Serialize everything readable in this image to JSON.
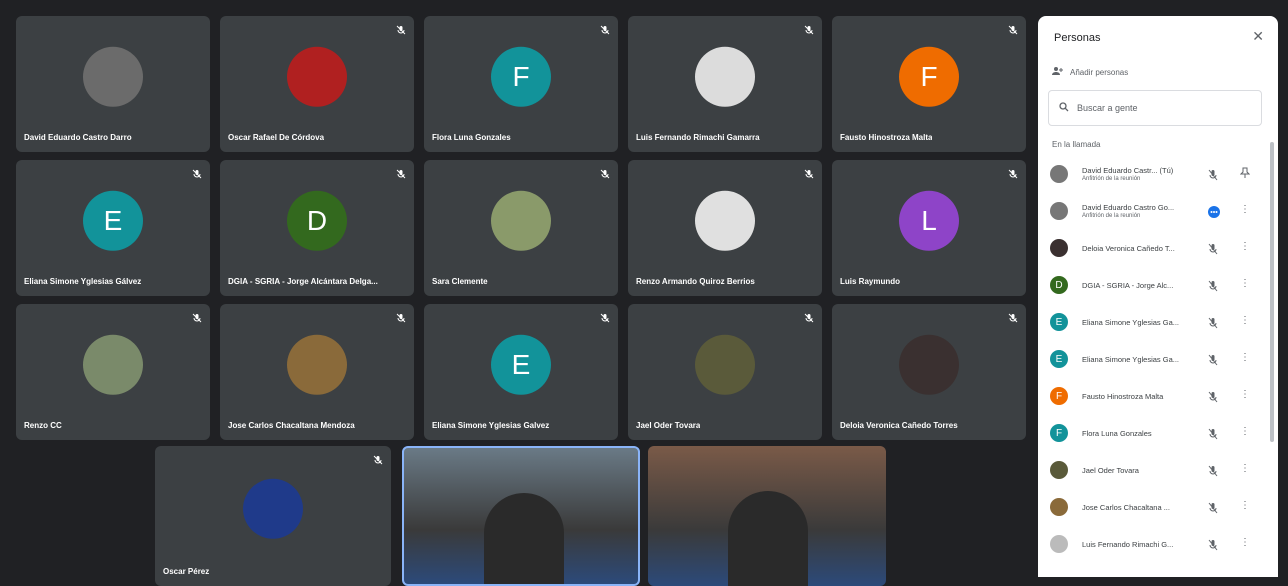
{
  "tiles": [
    {
      "name": "David Eduardo Castro Darro",
      "type": "photo",
      "avatar_color": "#6b6b6b"
    },
    {
      "name": "Oscar Rafael De Córdova",
      "type": "photo",
      "avatar_color": "#b02020"
    },
    {
      "name": "Flora Luna Gonzales",
      "type": "letter",
      "letter": "F",
      "avatar_color": "#12939a"
    },
    {
      "name": "Luis Fernando Rimachi Gamarra",
      "type": "photo",
      "avatar_color": "#dcdcdc"
    },
    {
      "name": "Fausto Hinostroza Malta",
      "type": "letter",
      "letter": "F",
      "avatar_color": "#ef6c00"
    },
    {
      "name": "Eliana Simone Yglesias Gálvez",
      "type": "letter",
      "letter": "E",
      "avatar_color": "#12939a"
    },
    {
      "name": "DGIA - SGRIA - Jorge Alcántara Delga...",
      "type": "letter",
      "letter": "D",
      "avatar_color": "#33691e"
    },
    {
      "name": "Sara Clemente",
      "type": "photo",
      "avatar_color": "#8a9a6a"
    },
    {
      "name": "Renzo Armando Quiroz Berrios",
      "type": "photo",
      "avatar_color": "#e0e0e0"
    },
    {
      "name": "Luis Raymundo",
      "type": "letter",
      "letter": "L",
      "avatar_color": "#8e44c8"
    },
    {
      "name": "Renzo CC",
      "type": "photo",
      "avatar_color": "#7a8a6a"
    },
    {
      "name": "Jose Carlos Chacaltana Mendoza",
      "type": "photo",
      "avatar_color": "#8a6a3a"
    },
    {
      "name": "Eliana Simone Yglesias Galvez",
      "type": "letter",
      "letter": "E",
      "avatar_color": "#12939a"
    },
    {
      "name": "Jael Oder Tovara",
      "type": "photo",
      "avatar_color": "#5a5a3a"
    },
    {
      "name": "Deloia Veronica Cañedo Torres",
      "type": "photo",
      "avatar_color": "#3a3030"
    },
    {
      "name": "Oscar Pérez",
      "type": "photo",
      "avatar_color": "#1f3a8a"
    }
  ],
  "panel": {
    "title": "Personas",
    "close_icon": "close-icon",
    "add_label": "Añadir personas",
    "search_placeholder": "Buscar a gente",
    "section_label": "En la llamada",
    "participants": [
      {
        "name": "David Eduardo Castr... (Tú)",
        "role": "Anfitrión de la reunión",
        "color": "#777",
        "letter": "",
        "action": "pin-icon"
      },
      {
        "name": "David Eduardo Castro Go...",
        "role": "Anfitrión de la reunión",
        "color": "#777",
        "letter": "",
        "action": "more-icon"
      },
      {
        "name": "Deloia Veronica Cañedo T...",
        "role": "",
        "color": "#3a3030",
        "letter": "",
        "action": "more-icon"
      },
      {
        "name": "DGIA - SGRIA - Jorge Alc...",
        "role": "",
        "color": "#33691e",
        "letter": "D",
        "action": "more-icon"
      },
      {
        "name": "Eliana Simone Yglesias Ga...",
        "role": "",
        "color": "#12939a",
        "letter": "E",
        "action": "more-icon"
      },
      {
        "name": "Eliana Simone Yglesias Ga...",
        "role": "",
        "color": "#12939a",
        "letter": "E",
        "action": "more-icon"
      },
      {
        "name": "Fausto Hinostroza Malta",
        "role": "",
        "color": "#ef6c00",
        "letter": "F",
        "action": "more-icon"
      },
      {
        "name": "Flora Luna Gonzales",
        "role": "",
        "color": "#12939a",
        "letter": "F",
        "action": "more-icon"
      },
      {
        "name": "Jael Oder Tovara",
        "role": "",
        "color": "#5a5a3a",
        "letter": "",
        "action": "more-icon"
      },
      {
        "name": "Jose Carlos Chacaltana ...",
        "role": "",
        "color": "#8a6a3a",
        "letter": "",
        "action": "more-icon"
      },
      {
        "name": "Luis Fernando Rimachi G...",
        "role": "",
        "color": "#bbb",
        "letter": "",
        "action": "more-icon"
      }
    ]
  }
}
